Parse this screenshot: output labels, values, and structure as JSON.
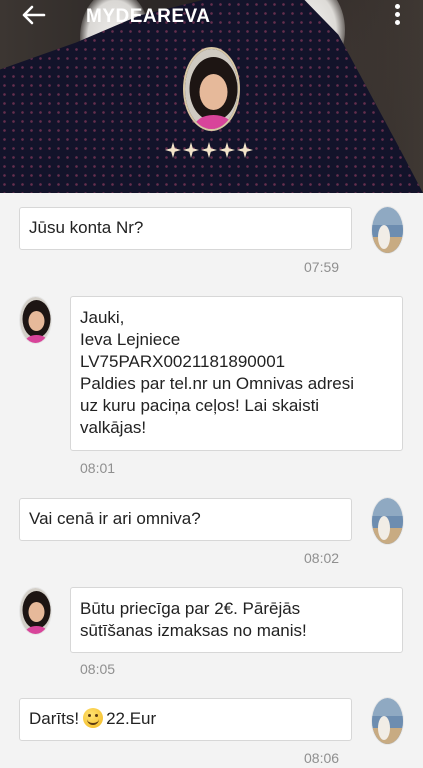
{
  "header": {
    "title": "MYDEAREVA",
    "back_icon": "arrow-left-icon",
    "menu_icon": "more-vertical-icon",
    "rating_stars": 5,
    "star_color": "#f2e3c9"
  },
  "messages": [
    {
      "side": "me",
      "text": "Jūsu konta Nr?",
      "time": "07:59"
    },
    {
      "side": "her",
      "text": "Jauki,\nIeva Lejniece\nLV75PARX0021181890001\nPaldies par tel.nr un Omnivas adresi\nuz kuru paciņa ceļos! Lai skaisti\nvalkājas!",
      "time": "08:01"
    },
    {
      "side": "me",
      "text": "Vai cenā ir ari omniva?",
      "time": "08:02"
    },
    {
      "side": "her",
      "text": "Būtu priecīga par 2€. Pārējās\nsūtīšanas izmaksas no manis!",
      "time": "08:05"
    },
    {
      "side": "me",
      "text_before": "Darīts!",
      "emoji": "smiling-face-emoji",
      "text_after": "22.Eur",
      "time": "08:06"
    }
  ]
}
